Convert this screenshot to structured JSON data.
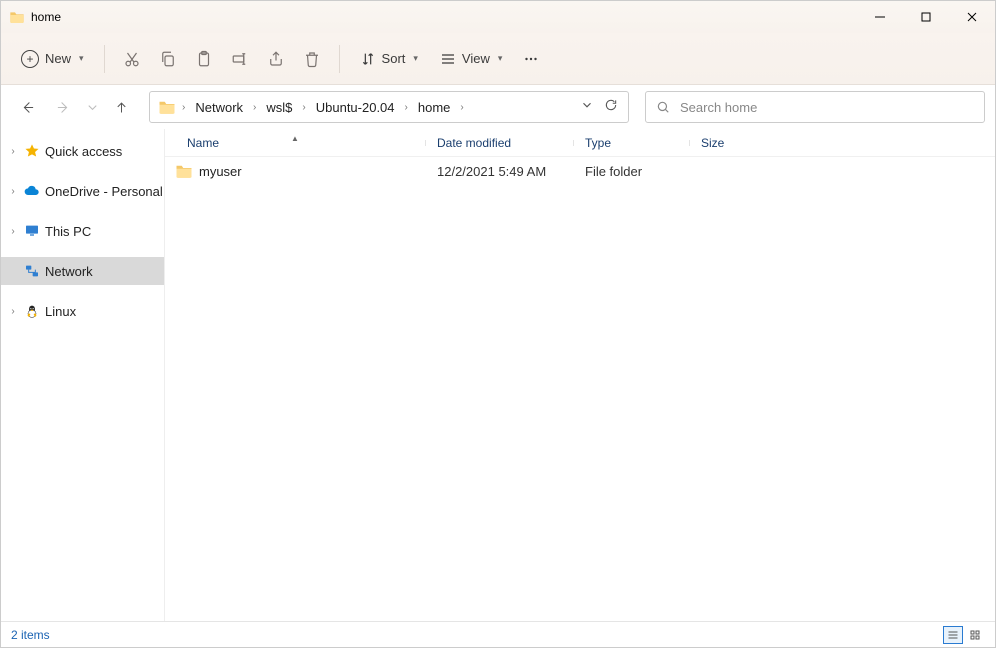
{
  "window": {
    "title": "home"
  },
  "ribbon": {
    "new_label": "New",
    "sort_label": "Sort",
    "view_label": "View"
  },
  "breadcrumb": {
    "items": [
      "Network",
      "wsl$",
      "Ubuntu-20.04",
      "home"
    ]
  },
  "search": {
    "placeholder": "Search home"
  },
  "sidebar": {
    "items": [
      {
        "label": "Quick access",
        "icon": "star",
        "selected": false
      },
      {
        "label": "OneDrive - Personal",
        "icon": "cloud",
        "selected": false
      },
      {
        "label": "This PC",
        "icon": "monitor",
        "selected": false
      },
      {
        "label": "Network",
        "icon": "network",
        "selected": true
      },
      {
        "label": "Linux",
        "icon": "linux",
        "selected": false
      }
    ]
  },
  "columns": {
    "name": "Name",
    "date": "Date modified",
    "type": "Type",
    "size": "Size"
  },
  "rows": [
    {
      "name": "myuser",
      "date": "12/2/2021 5:49 AM",
      "type": "File folder",
      "size": ""
    }
  ],
  "status": {
    "text": "2 items"
  }
}
